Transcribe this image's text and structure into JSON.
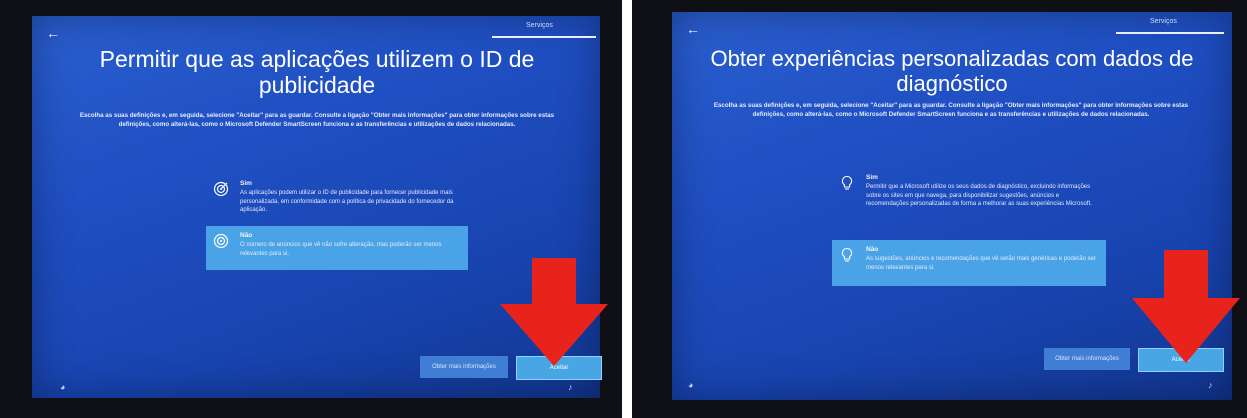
{
  "left": {
    "tab_label": "Serviços",
    "title": "Permitir que as aplicações utilizem o ID de publicidade",
    "description": "Escolha as suas definições e, em seguida, selecione \"Aceitar\" para as guardar. Consulte a ligação \"Obter mais informações\" para obter informações sobre estas definições, como alterá-las, como o Microsoft Defender SmartScreen funciona e as transferências e utilizações de dados relacionadas.",
    "option_yes": {
      "title": "Sim",
      "desc": "As aplicações podem utilizar o ID de publicidade para fornecer publicidade mais personalizada, em conformidade com a política de privacidade do fornecedor da aplicação."
    },
    "option_no": {
      "title": "Não",
      "desc": "O número de anúncios que vê não sofre alteração, mas poderão ser menos relevantes para si."
    },
    "learn_more_label": "Obter mais informações",
    "accept_label": "Aceitar"
  },
  "right": {
    "tab_label": "Serviços",
    "title": "Obter experiências personalizadas com dados de diagnóstico",
    "description": "Escolha as suas definições e, em seguida, selecione \"Aceitar\" para as guardar. Consulte a ligação \"Obter mais informações\" para obter informações sobre estas definições, como alterá-las, como o Microsoft Defender SmartScreen funciona e as transferências e utilizações de dados relacionadas.",
    "option_yes": {
      "title": "Sim",
      "desc": "Permitir que a Microsoft utilize os seus dados de diagnóstico, excluindo informações sobre os sites em que navega, para disponibilizar sugestões, anúncios e recomendações personalizadas de forma a melhorar as suas experiências Microsoft."
    },
    "option_no": {
      "title": "Não",
      "desc": "As sugestões, anúncios e recomendações que vê serão mais genéricas e poderão ser menos relevantes para si."
    },
    "learn_more_label": "Obter mais informações",
    "accept_label": "Aceitar"
  },
  "icons": {
    "back": "back-arrow-icon",
    "accessibility": "accessibility-icon",
    "volume": "volume-icon",
    "target": "target-icon",
    "lightbulb": "lightbulb-icon",
    "red_arrow": "red-down-arrow-icon"
  },
  "colors": {
    "screen_blue": "#1f4fc2",
    "selected_option": "#4aa3e6",
    "accept_button": "#49a6e4",
    "annotation_arrow": "#e8231c"
  }
}
